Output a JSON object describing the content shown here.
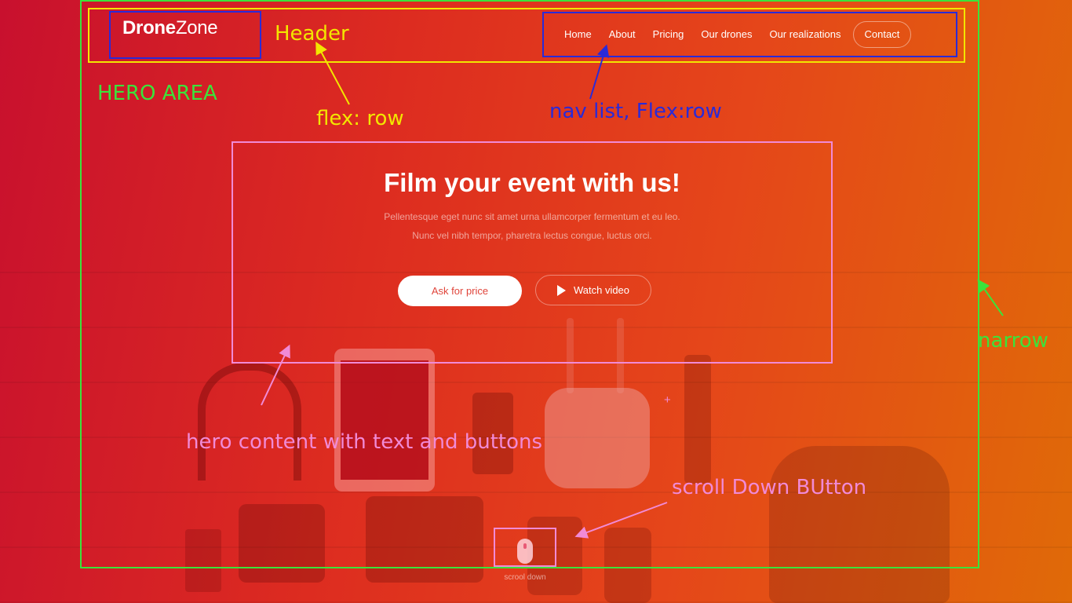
{
  "brand": {
    "bold": "Drone",
    "light": "Zone"
  },
  "nav": {
    "items": [
      {
        "label": "Home"
      },
      {
        "label": "About"
      },
      {
        "label": "Pricing"
      },
      {
        "label": "Our drones"
      },
      {
        "label": "Our realizations"
      },
      {
        "label": "Contact"
      }
    ]
  },
  "hero": {
    "title": "Film your event with us!",
    "subtitle_line1": "Pellentesque eget nunc sit amet urna ullamcorper fermentum et eu leo.",
    "subtitle_line2": "Nunc vel nibh tempor, pharetra lectus congue, luctus orci.",
    "primary_button": "Ask for price",
    "secondary_button": "Watch video",
    "scroll_label": "scrool down"
  },
  "annotations": {
    "header": "Header",
    "hero_area": "HERO AREA",
    "flex_row": "flex: row",
    "nav_list": "nav list, Flex:row",
    "narrow": "narrow",
    "hero_content": "hero content with text and buttons",
    "scroll_button": "scroll Down BUtton",
    "plus_mark": "+"
  },
  "colors": {
    "hero_box": "#3be33b",
    "header_box": "#f2e600",
    "nav_box": "#2a2ad8",
    "content_box": "#f18ad6",
    "gradient_start": "#c8102e",
    "gradient_end": "#e06a08"
  },
  "icons": [
    "play-icon",
    "mouse-icon"
  ]
}
